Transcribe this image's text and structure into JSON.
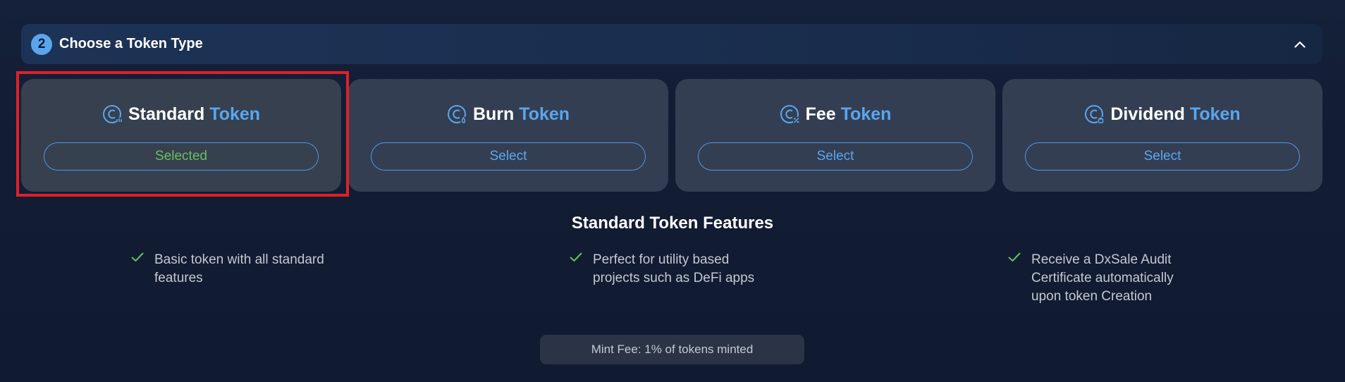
{
  "step": {
    "number": "2",
    "title": "Choose a Token Type"
  },
  "token_types": [
    {
      "name": "Standard",
      "suffix": "Token",
      "button_label": "Selected",
      "selected": true
    },
    {
      "name": "Burn",
      "suffix": "Token",
      "button_label": "Select",
      "selected": false
    },
    {
      "name": "Fee",
      "suffix": "Token",
      "button_label": "Select",
      "selected": false
    },
    {
      "name": "Dividend",
      "suffix": "Token",
      "button_label": "Select",
      "selected": false
    }
  ],
  "features": {
    "title": "Standard Token Features",
    "items": [
      {
        "line1": "Basic token with all standard",
        "line2": "features",
        "line3": ""
      },
      {
        "line1": "Perfect for utility based",
        "line2": "projects such as DeFi apps",
        "line3": ""
      },
      {
        "line1": "Receive a DxSale Audit",
        "line2": "Certificate automatically",
        "line3": "upon token Creation"
      }
    ]
  },
  "mint_fee": "Mint Fee: 1% of tokens minted",
  "colors": {
    "accent": "#5aa6ee",
    "selected": "#6abf5e",
    "highlight": "#e02028",
    "check": "#6abf5e"
  },
  "icons": {
    "step_badge": "step-number-badge",
    "collapse": "chevron-up-icon",
    "token": "coin-icon",
    "check": "check-icon"
  }
}
